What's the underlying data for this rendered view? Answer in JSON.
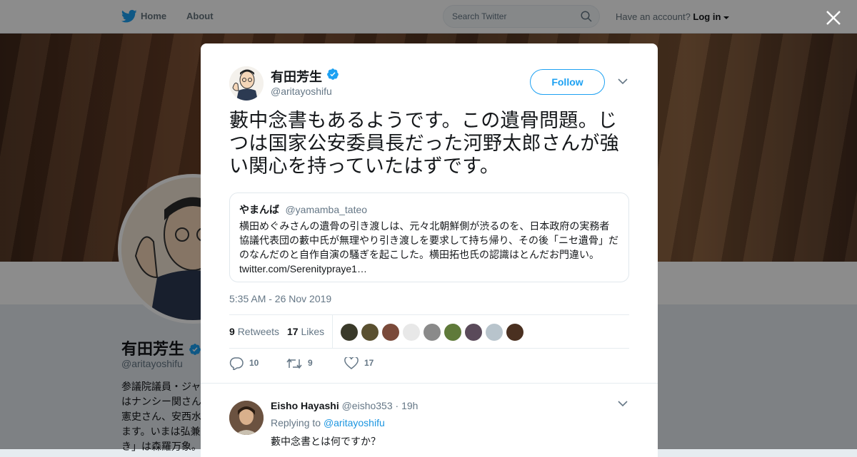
{
  "nav": {
    "home": "Home",
    "about": "About",
    "search_placeholder": "Search Twitter",
    "have_account": "Have an account?",
    "login": "Log in"
  },
  "background_profile": {
    "name": "有田芳生",
    "handle": "@aritayoshifu",
    "bio_lines": [
      "参議院議員・ジャ",
      "はナンシー関さん",
      "憲史さん、安西水",
      "ます。いまは弘兼",
      "き」は森羅万象。"
    ]
  },
  "tweet": {
    "author_name": "有田芳生",
    "author_handle": "@aritayoshifu",
    "follow_label": "Follow",
    "text": "藪中念書もあるようです。この遺骨問題。じつは国家公安委員長だった河野太郎さんが強い関心を持っていたはずです。",
    "quoted": {
      "name": "やまんば",
      "handle": "@yamamba_tateo",
      "text": "横田めぐみさんの遺骨の引き渡しは、元々北朝鮮側が渋るのを、日本政府の実務者協議代表団の藪中氏が無理やり引き渡しを要求して持ち帰り、その後「ニセ遺骨」だのなんだのと自作自演の騒ぎを起こした。横田拓也氏の認識はとんだお門違い。",
      "link": "twitter.com/Serenityprayе1…"
    },
    "timestamp": "5:35 AM - 26 Nov 2019",
    "retweets_count": "9",
    "retweets_label": "Retweets",
    "likes_count": "17",
    "likes_label": "Likes",
    "likers": [
      {
        "name": "liker-1",
        "color": "#3a3a2a"
      },
      {
        "name": "liker-2",
        "color": "#5a5030"
      },
      {
        "name": "liker-3",
        "color": "#7a4a3a"
      },
      {
        "name": "liker-4",
        "color": "#e8e8e8"
      },
      {
        "name": "liker-5",
        "color": "#8a8a8a"
      },
      {
        "name": "liker-6",
        "color": "#5f7a3a"
      },
      {
        "name": "liker-7",
        "color": "#5a4a5a"
      },
      {
        "name": "liker-8",
        "color": "#b8c4cc"
      },
      {
        "name": "liker-9",
        "color": "#4a3020"
      }
    ],
    "actions": {
      "replies": "10",
      "retweets": "9",
      "likes": "17"
    }
  },
  "reply": {
    "name": "Eisho Hayashi",
    "handle": "@eisho353",
    "time": "19h",
    "replying_prefix": "Replying to",
    "replying_to": "@aritayoshifu",
    "text": "藪中念書とは何ですか？"
  },
  "colors": {
    "accent": "#1da1f2",
    "verified": "#1da1f2"
  }
}
